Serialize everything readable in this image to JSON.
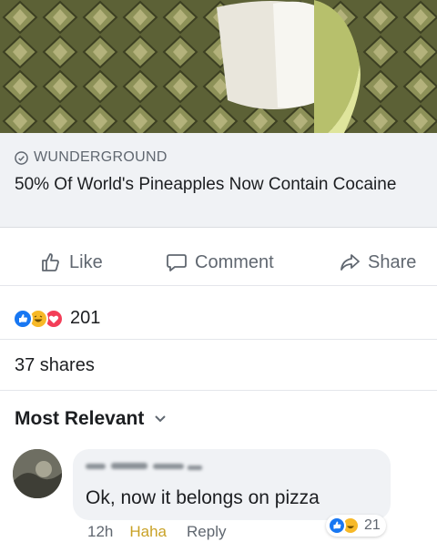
{
  "post": {
    "link": {
      "source": "WUNDERGROUND",
      "headline": "50% Of World's Pineapples Now Contain Cocaine"
    },
    "actions": {
      "like": "Like",
      "comment": "Comment",
      "share": "Share"
    },
    "reactions": {
      "types": [
        "like",
        "haha",
        "love"
      ],
      "count": "201"
    },
    "shares": "37 shares"
  },
  "comments": {
    "sort_label": "Most Relevant",
    "items": [
      {
        "text": "Ok, now it belongs on pizza",
        "time": "12h",
        "haha": "Haha",
        "reply": "Reply",
        "reaction_types": [
          "like",
          "haha"
        ],
        "reaction_count": "21"
      }
    ]
  },
  "colors": {
    "facebook_blue": "#1877f2",
    "haha_yellow": "#f7b928",
    "love_red": "#f33e58",
    "link_bg": "#f0f2f5",
    "muted_text": "#606770"
  }
}
